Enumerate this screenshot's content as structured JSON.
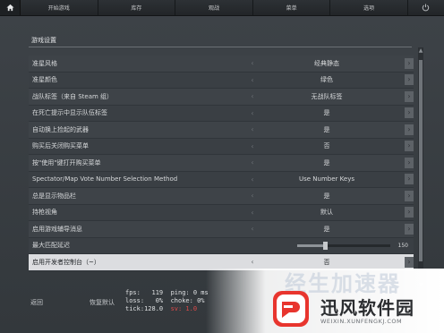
{
  "nav": {
    "tabs": [
      "开始游戏",
      "库存",
      "观战",
      "菜单",
      "选项"
    ]
  },
  "section": {
    "title": "游戏设置"
  },
  "rows": [
    {
      "label": "准星风格",
      "value": "经典静态"
    },
    {
      "label": "准星颜色",
      "value": "绿色"
    },
    {
      "label": "战队标签（来自 Steam 组）",
      "value": "无战队标签"
    },
    {
      "label": "在死亡提示中显示队伍标签",
      "value": "是"
    },
    {
      "label": "自动换上捡起的武器",
      "value": "是"
    },
    {
      "label": "购买后关闭购买菜单",
      "value": "否"
    },
    {
      "label": "按\"使用\"键打开购买菜单",
      "value": "是"
    },
    {
      "label": "Spectator/Map Vote Number Selection Method",
      "value": "Use Number Keys"
    },
    {
      "label": "总是显示物品栏",
      "value": "是"
    },
    {
      "label": "持枪视角",
      "value": "默认"
    },
    {
      "label": "启用游戏辅导消息",
      "value": "是"
    },
    {
      "label": "最大匹配延迟",
      "value": "150",
      "level": 0.3
    },
    {
      "label": "启用开发者控制台（~）",
      "value": "否"
    }
  ],
  "bottom": {
    "back": "返回",
    "restore": "恢复默认",
    "netgraph": {
      "line1": "fps:   119  ping: 0 ms",
      "line2": "loss:   0%  choke: 0%",
      "line3": "tick:128.0  ",
      "line3_red": "sv: 1.0"
    }
  },
  "watermark": {
    "ghost": "经生加速器",
    "main": "迅风软件园",
    "sub": "WEIXIN.XUNFENGKJ.COM"
  },
  "colors": {
    "active_row": "#dcdde0",
    "background": "#3a3f44"
  }
}
